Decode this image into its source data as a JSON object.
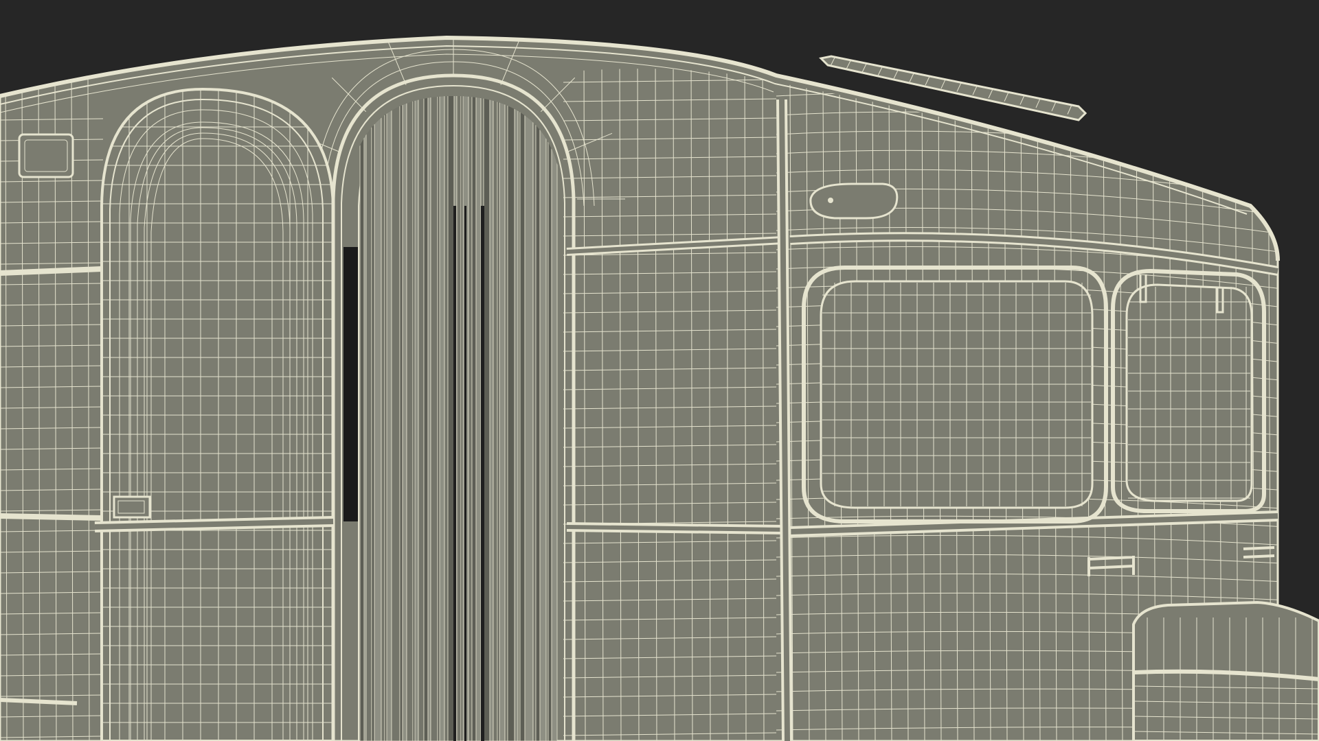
{
  "scene": {
    "subject": "wireframe-trailer-model",
    "colors": {
      "background": "#262626",
      "surface": "#7b7c70",
      "surface_dark": "#6d6e63",
      "wire": "#e6e4cf",
      "opening": "#1b1b1b",
      "curtain": "#8b8c80"
    }
  }
}
